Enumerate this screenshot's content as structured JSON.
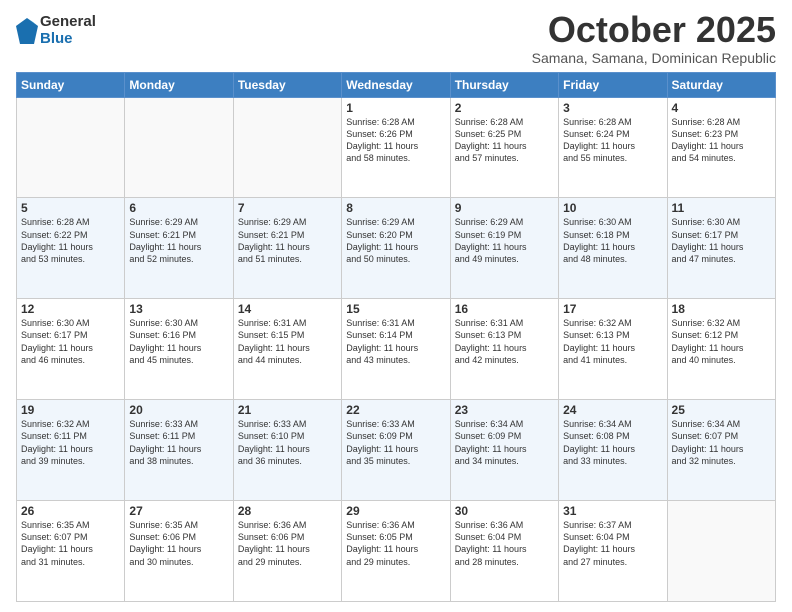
{
  "header": {
    "logo_general": "General",
    "logo_blue": "Blue",
    "month": "October 2025",
    "location": "Samana, Samana, Dominican Republic"
  },
  "weekdays": [
    "Sunday",
    "Monday",
    "Tuesday",
    "Wednesday",
    "Thursday",
    "Friday",
    "Saturday"
  ],
  "weeks": [
    [
      {
        "day": "",
        "info": ""
      },
      {
        "day": "",
        "info": ""
      },
      {
        "day": "",
        "info": ""
      },
      {
        "day": "1",
        "info": "Sunrise: 6:28 AM\nSunset: 6:26 PM\nDaylight: 11 hours\nand 58 minutes."
      },
      {
        "day": "2",
        "info": "Sunrise: 6:28 AM\nSunset: 6:25 PM\nDaylight: 11 hours\nand 57 minutes."
      },
      {
        "day": "3",
        "info": "Sunrise: 6:28 AM\nSunset: 6:24 PM\nDaylight: 11 hours\nand 55 minutes."
      },
      {
        "day": "4",
        "info": "Sunrise: 6:28 AM\nSunset: 6:23 PM\nDaylight: 11 hours\nand 54 minutes."
      }
    ],
    [
      {
        "day": "5",
        "info": "Sunrise: 6:28 AM\nSunset: 6:22 PM\nDaylight: 11 hours\nand 53 minutes."
      },
      {
        "day": "6",
        "info": "Sunrise: 6:29 AM\nSunset: 6:21 PM\nDaylight: 11 hours\nand 52 minutes."
      },
      {
        "day": "7",
        "info": "Sunrise: 6:29 AM\nSunset: 6:21 PM\nDaylight: 11 hours\nand 51 minutes."
      },
      {
        "day": "8",
        "info": "Sunrise: 6:29 AM\nSunset: 6:20 PM\nDaylight: 11 hours\nand 50 minutes."
      },
      {
        "day": "9",
        "info": "Sunrise: 6:29 AM\nSunset: 6:19 PM\nDaylight: 11 hours\nand 49 minutes."
      },
      {
        "day": "10",
        "info": "Sunrise: 6:30 AM\nSunset: 6:18 PM\nDaylight: 11 hours\nand 48 minutes."
      },
      {
        "day": "11",
        "info": "Sunrise: 6:30 AM\nSunset: 6:17 PM\nDaylight: 11 hours\nand 47 minutes."
      }
    ],
    [
      {
        "day": "12",
        "info": "Sunrise: 6:30 AM\nSunset: 6:17 PM\nDaylight: 11 hours\nand 46 minutes."
      },
      {
        "day": "13",
        "info": "Sunrise: 6:30 AM\nSunset: 6:16 PM\nDaylight: 11 hours\nand 45 minutes."
      },
      {
        "day": "14",
        "info": "Sunrise: 6:31 AM\nSunset: 6:15 PM\nDaylight: 11 hours\nand 44 minutes."
      },
      {
        "day": "15",
        "info": "Sunrise: 6:31 AM\nSunset: 6:14 PM\nDaylight: 11 hours\nand 43 minutes."
      },
      {
        "day": "16",
        "info": "Sunrise: 6:31 AM\nSunset: 6:13 PM\nDaylight: 11 hours\nand 42 minutes."
      },
      {
        "day": "17",
        "info": "Sunrise: 6:32 AM\nSunset: 6:13 PM\nDaylight: 11 hours\nand 41 minutes."
      },
      {
        "day": "18",
        "info": "Sunrise: 6:32 AM\nSunset: 6:12 PM\nDaylight: 11 hours\nand 40 minutes."
      }
    ],
    [
      {
        "day": "19",
        "info": "Sunrise: 6:32 AM\nSunset: 6:11 PM\nDaylight: 11 hours\nand 39 minutes."
      },
      {
        "day": "20",
        "info": "Sunrise: 6:33 AM\nSunset: 6:11 PM\nDaylight: 11 hours\nand 38 minutes."
      },
      {
        "day": "21",
        "info": "Sunrise: 6:33 AM\nSunset: 6:10 PM\nDaylight: 11 hours\nand 36 minutes."
      },
      {
        "day": "22",
        "info": "Sunrise: 6:33 AM\nSunset: 6:09 PM\nDaylight: 11 hours\nand 35 minutes."
      },
      {
        "day": "23",
        "info": "Sunrise: 6:34 AM\nSunset: 6:09 PM\nDaylight: 11 hours\nand 34 minutes."
      },
      {
        "day": "24",
        "info": "Sunrise: 6:34 AM\nSunset: 6:08 PM\nDaylight: 11 hours\nand 33 minutes."
      },
      {
        "day": "25",
        "info": "Sunrise: 6:34 AM\nSunset: 6:07 PM\nDaylight: 11 hours\nand 32 minutes."
      }
    ],
    [
      {
        "day": "26",
        "info": "Sunrise: 6:35 AM\nSunset: 6:07 PM\nDaylight: 11 hours\nand 31 minutes."
      },
      {
        "day": "27",
        "info": "Sunrise: 6:35 AM\nSunset: 6:06 PM\nDaylight: 11 hours\nand 30 minutes."
      },
      {
        "day": "28",
        "info": "Sunrise: 6:36 AM\nSunset: 6:06 PM\nDaylight: 11 hours\nand 29 minutes."
      },
      {
        "day": "29",
        "info": "Sunrise: 6:36 AM\nSunset: 6:05 PM\nDaylight: 11 hours\nand 29 minutes."
      },
      {
        "day": "30",
        "info": "Sunrise: 6:36 AM\nSunset: 6:04 PM\nDaylight: 11 hours\nand 28 minutes."
      },
      {
        "day": "31",
        "info": "Sunrise: 6:37 AM\nSunset: 6:04 PM\nDaylight: 11 hours\nand 27 minutes."
      },
      {
        "day": "",
        "info": ""
      }
    ]
  ]
}
